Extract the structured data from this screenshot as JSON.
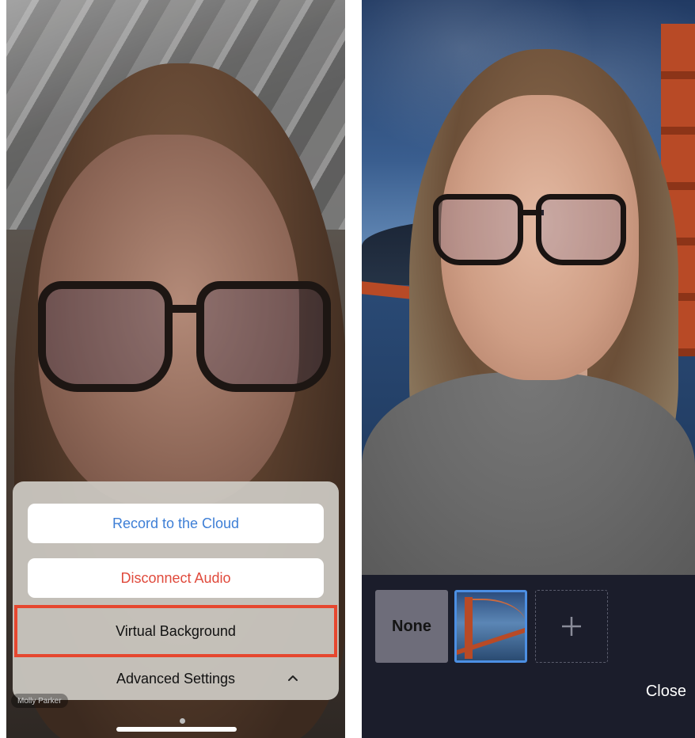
{
  "left_screen": {
    "action_sheet": {
      "record_label": "Record to the Cloud",
      "disconnect_label": "Disconnect Audio",
      "virtual_background_label": "Virtual Background",
      "advanced_settings_label": "Advanced Settings"
    },
    "name_tag": "Molly Parker",
    "colors": {
      "record": "#3e7fd6",
      "disconnect": "#e04a3c",
      "highlight_border": "#e6472f"
    }
  },
  "right_screen": {
    "background_options": {
      "none_label": "None",
      "selected_background_icon": "golden-gate-bridge-thumbnail",
      "add_icon": "plus-icon"
    },
    "close_label": "Close",
    "colors": {
      "tray": "#1b1d2b",
      "selected_border": "#4c8fe3"
    }
  }
}
